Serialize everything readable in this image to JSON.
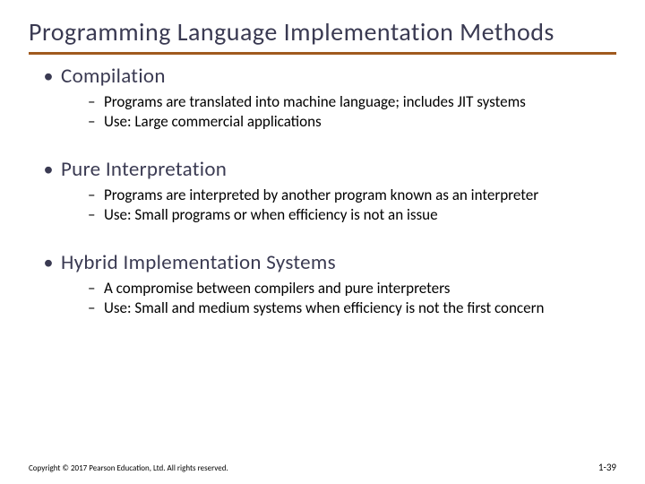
{
  "title": "Programming Language Implementation Methods",
  "sections": [
    {
      "heading": "Compilation",
      "points": [
        "Programs are translated into machine language; includes JIT systems",
        "Use: Large commercial applications"
      ]
    },
    {
      "heading": "Pure Interpretation",
      "points": [
        "Programs are interpreted by another program known as an interpreter",
        "Use: Small programs or when efficiency is not an issue"
      ]
    },
    {
      "heading": "Hybrid Implementation Systems",
      "points": [
        "A compromise between compilers and pure interpreters",
        "Use: Small and medium systems when efficiency is not the first concern"
      ]
    }
  ],
  "footer": "Copyright © 2017 Pearson Education, Ltd. All rights reserved.",
  "pagenum": "1-39"
}
